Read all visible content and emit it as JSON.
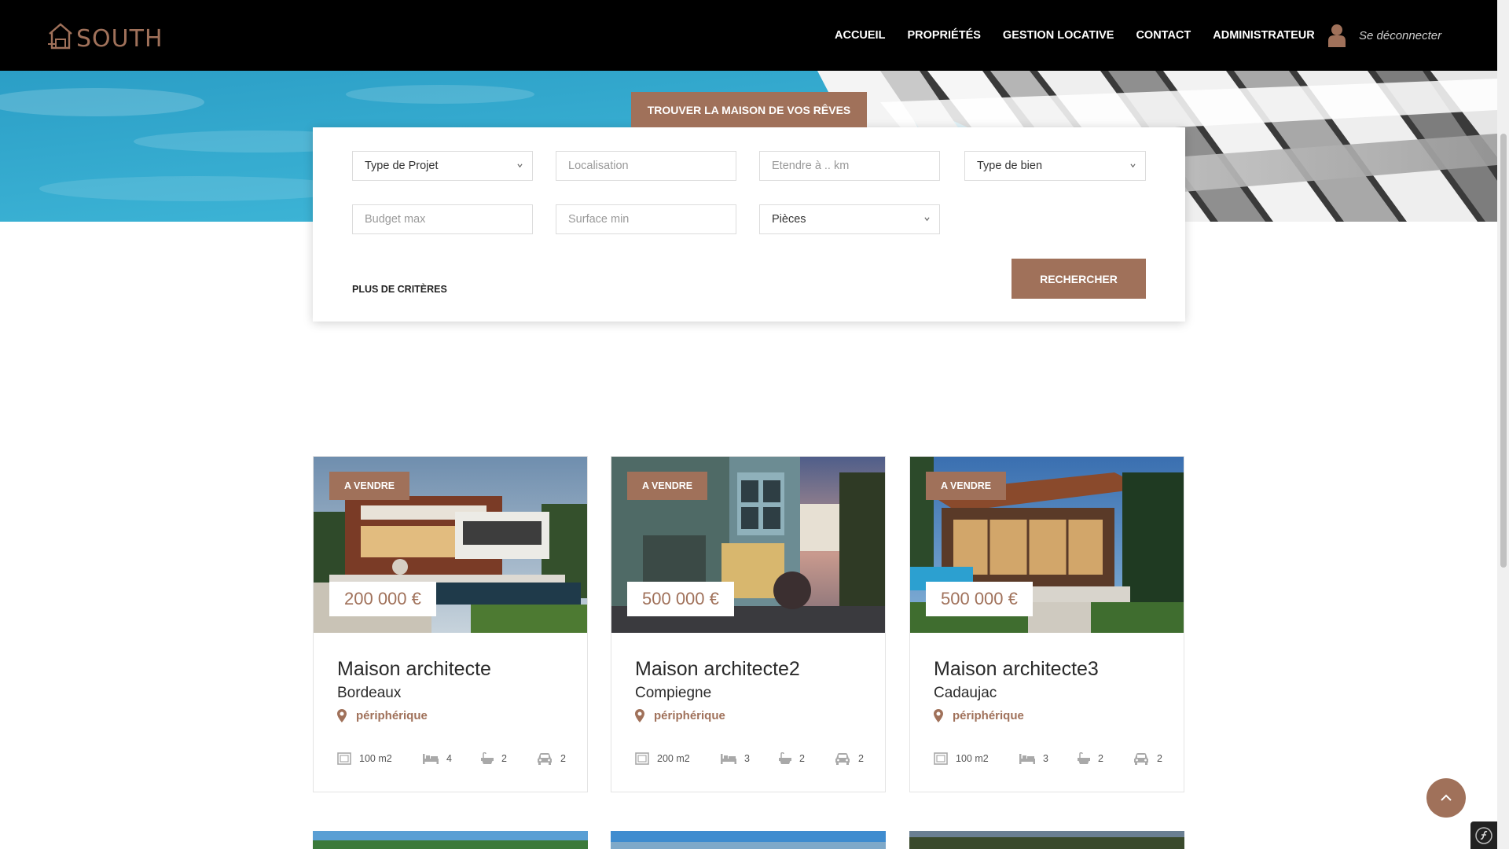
{
  "header": {
    "logo_text": "SOUTH",
    "nav": [
      "ACCUEIL",
      "PROPRIÉTÉS",
      "GESTION LOCATIVE",
      "CONTACT",
      "ADMINISTRATEUR"
    ],
    "user_link": "Se déconnecter",
    "user_icon": "user-icon"
  },
  "search": {
    "tab_label": "TROUVER LA MAISON DE VOS RÊVES",
    "project_type": "Type de Projet",
    "location_placeholder": "Localisation",
    "radius_placeholder": "Etendre à .. km",
    "property_type": "Type de bien",
    "budget_placeholder": "Budget max",
    "surface_placeholder": "Surface min",
    "rooms": "Pièces",
    "more_criteria": "PLUS DE CRITÈRES",
    "submit_label": "RECHERCHER"
  },
  "properties": [
    {
      "status": "A VENDRE",
      "price": "200 000 €",
      "title": "Maison architecte",
      "city": "Bordeaux",
      "zone": "périphérique",
      "surface": "100 m2",
      "bedrooms": "4",
      "bathrooms": "2",
      "parking": "2"
    },
    {
      "status": "A VENDRE",
      "price": "500 000 €",
      "title": "Maison architecte2",
      "city": "Compiegne",
      "zone": "périphérique",
      "surface": "200 m2",
      "bedrooms": "3",
      "bathrooms": "2",
      "parking": "2"
    },
    {
      "status": "A VENDRE",
      "price": "500 000 €",
      "title": "Maison architecte3",
      "city": "Cadaujac",
      "zone": "périphérique",
      "surface": "100 m2",
      "bedrooms": "3",
      "bathrooms": "2",
      "parking": "2"
    }
  ],
  "colors": {
    "accent": "#a0715a",
    "header_bg": "#000000",
    "sky": "#3ab7d9"
  }
}
